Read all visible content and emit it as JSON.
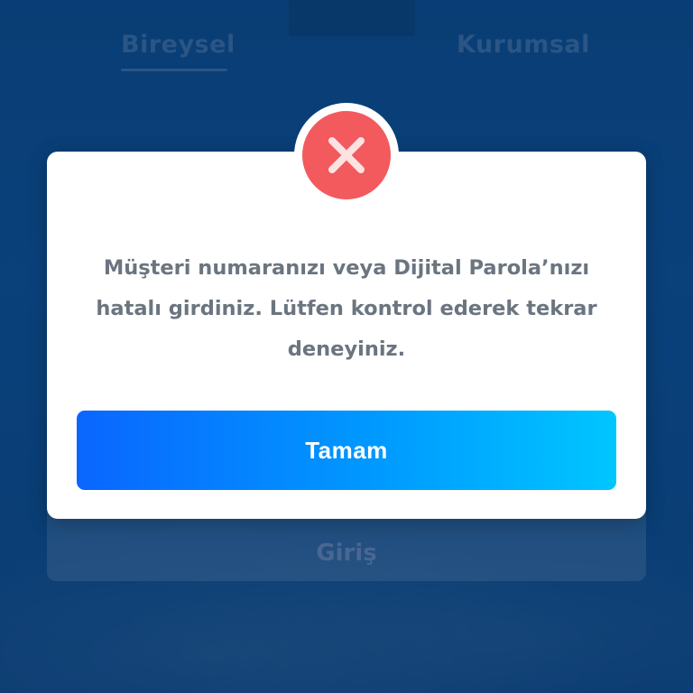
{
  "tabs": {
    "individual": "Bireysel",
    "corporate": "Kurumsal"
  },
  "login": {
    "label": "Giriş"
  },
  "dialog": {
    "icon": "error-x-icon",
    "message_lines": [
      "Müşteri numaranızı veya Dijital Parola’nızı",
      "hatalı girdiniz. Lütfen kontrol ederek tekrar",
      "deneyiniz."
    ],
    "ok_label": "Tamam"
  },
  "colors": {
    "background": "#0e5598",
    "error": "#f25a5e",
    "button_start": "#0a66ff",
    "button_end": "#00c6ff",
    "message_text": "#6b7580"
  }
}
